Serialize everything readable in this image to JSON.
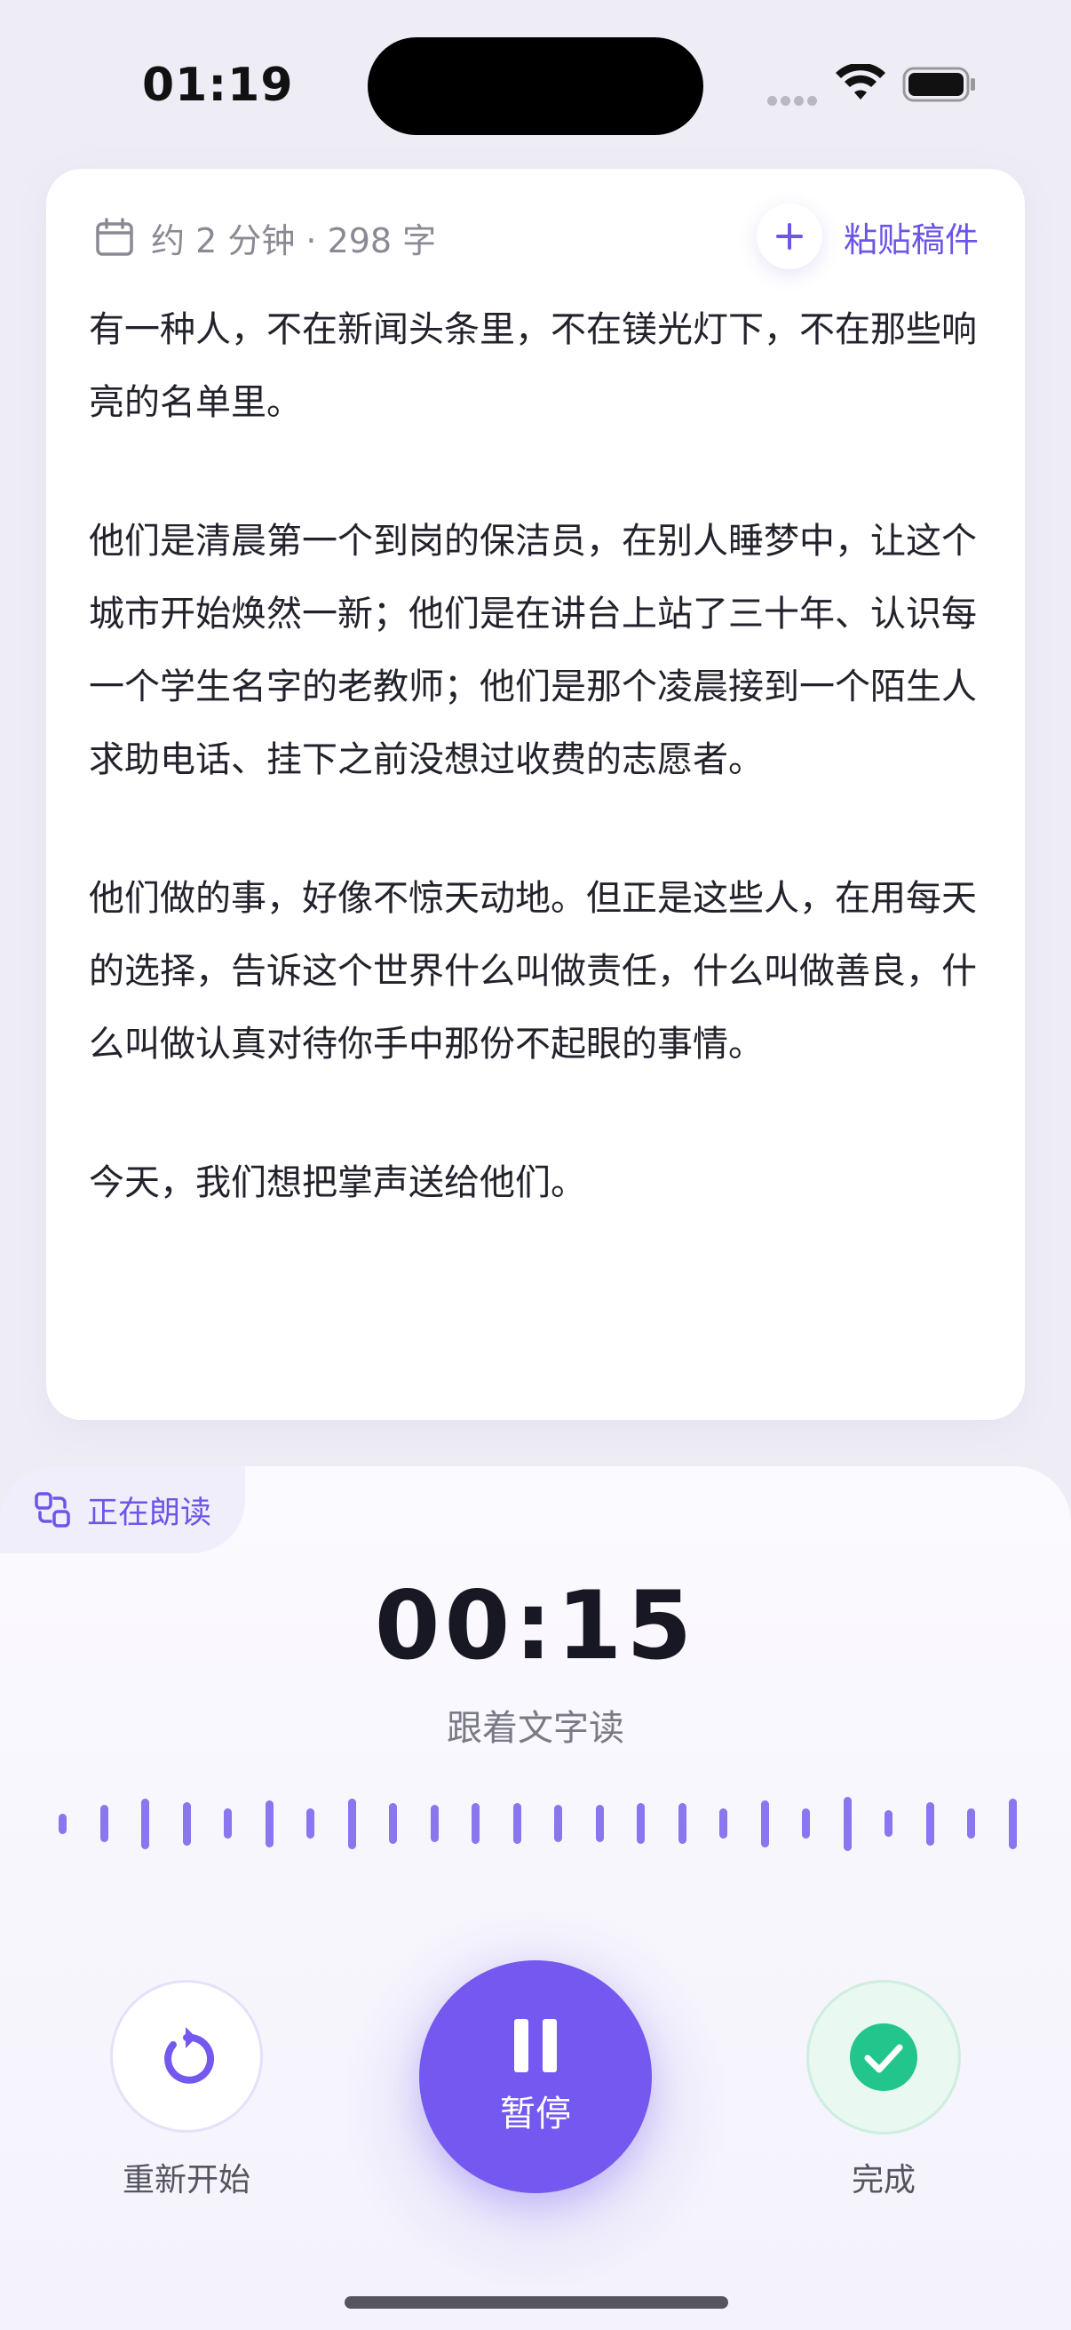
{
  "status_bar": {
    "time": "01:19"
  },
  "script_card": {
    "meta": "约 2 分钟 · 298 字",
    "paste_label": "粘贴稿件",
    "paragraphs": [
      "有一种人，不在新闻头条里，不在镁光灯下，不在那些响亮的名单里。",
      "他们是清晨第一个到岗的保洁员，在别人睡梦中，让这个城市开始焕然一新；他们是在讲台上站了三十年、认识每一个学生名字的老教师；他们是那个凌晨接到一个陌生人求助电话、挂下之前没想过收费的志愿者。",
      "他们做的事，好像不惊天动地。但正是这些人，在用每天的选择，告诉这个世界什么叫做责任，什么叫做善良，什么叫做认真对待你手中那份不起眼的事情。",
      "今天，我们想把掌声送给他们。"
    ]
  },
  "reading_panel": {
    "tag_label": "正在朗读",
    "timer": "00:15",
    "hint": "跟着文字读",
    "waveform_levels": [
      0.3,
      0.55,
      0.75,
      0.65,
      0.45,
      0.7,
      0.45,
      0.75,
      0.6,
      0.55,
      0.6,
      0.6,
      0.55,
      0.55,
      0.6,
      0.6,
      0.45,
      0.7,
      0.45,
      0.8,
      0.4,
      0.65,
      0.45,
      0.75
    ]
  },
  "controls": {
    "restart_label": "重新开始",
    "pause_label": "暂停",
    "done_label": "完成"
  },
  "colors": {
    "accent": "#7458ef",
    "success": "#22c58b",
    "background": "#eeedf6"
  },
  "icons": {
    "calendar": "calendar-icon",
    "plus": "plus-icon",
    "reading": "reading-mode-icon",
    "restart": "restart-icon",
    "pause": "pause-icon",
    "done": "check-icon"
  }
}
